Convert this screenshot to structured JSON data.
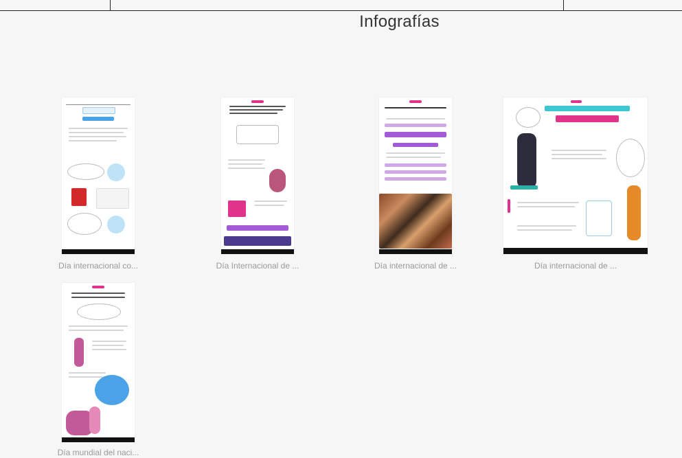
{
  "page": {
    "title": "Infografías"
  },
  "cards": [
    {
      "caption": "Día internacional co..."
    },
    {
      "caption": "Día Internacional de ..."
    },
    {
      "caption": "Día internacional de ..."
    },
    {
      "caption": "Día internacional de ..."
    },
    {
      "caption": "Día mundial del naci..."
    }
  ],
  "colors": {
    "background": "#f6f6f6",
    "pink": "#e0338a",
    "purple": "#a25bd6",
    "blue": "#4aa3e6",
    "teal": "#3ec7d1",
    "red": "#d22a2a"
  }
}
